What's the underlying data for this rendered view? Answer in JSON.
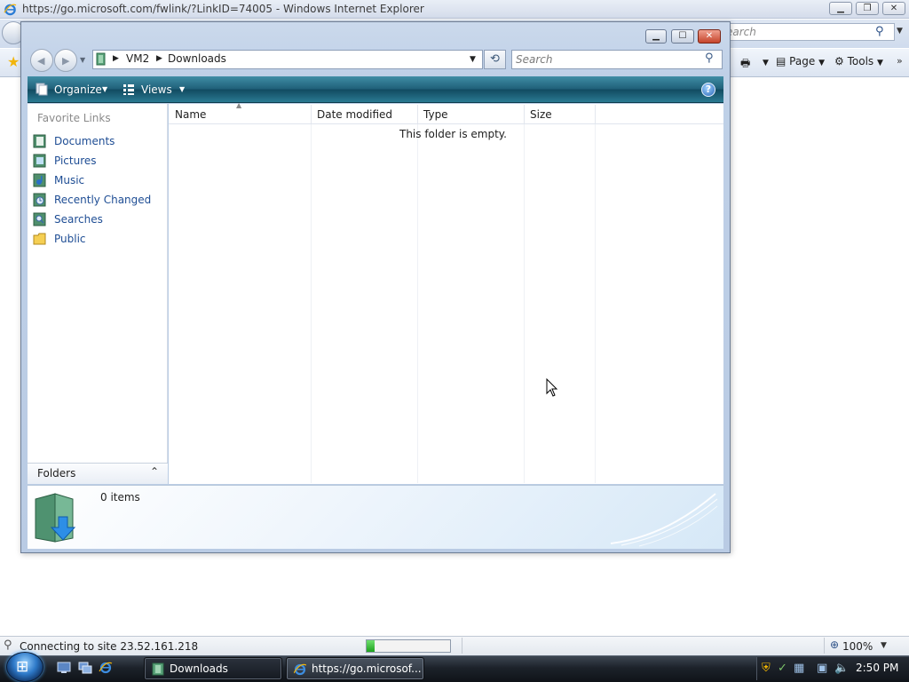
{
  "ie": {
    "title": "https://go.microsoft.com/fwlink/?LinkID=74005 - Windows Internet Explorer",
    "search_partial": "earch",
    "page_label": "Page",
    "tools_label": "Tools",
    "status_text": "Connecting to site 23.52.161.218",
    "progress_fraction": 0.1,
    "zoom": "100%"
  },
  "explorer": {
    "breadcrumb": [
      "VM2",
      "Downloads"
    ],
    "search_placeholder": "Search",
    "commands": {
      "organize": "Organize",
      "views": "Views"
    },
    "favorites_header": "Favorite Links",
    "favorites": [
      {
        "label": "Documents",
        "icon": "documents-icon"
      },
      {
        "label": "Pictures",
        "icon": "pictures-icon"
      },
      {
        "label": "Music",
        "icon": "music-icon"
      },
      {
        "label": "Recently Changed",
        "icon": "recently-changed-icon"
      },
      {
        "label": "Searches",
        "icon": "searches-icon"
      },
      {
        "label": "Public",
        "icon": "public-folder-icon"
      }
    ],
    "folders_label": "Folders",
    "columns": [
      "Name",
      "Date modified",
      "Type",
      "Size"
    ],
    "empty_message": "This folder is empty.",
    "item_count": "0 items"
  },
  "taskbar": {
    "buttons": [
      {
        "label": "Downloads",
        "active": true
      },
      {
        "label": "https://go.microsof...",
        "active": false
      }
    ],
    "clock": "2:50 PM"
  }
}
